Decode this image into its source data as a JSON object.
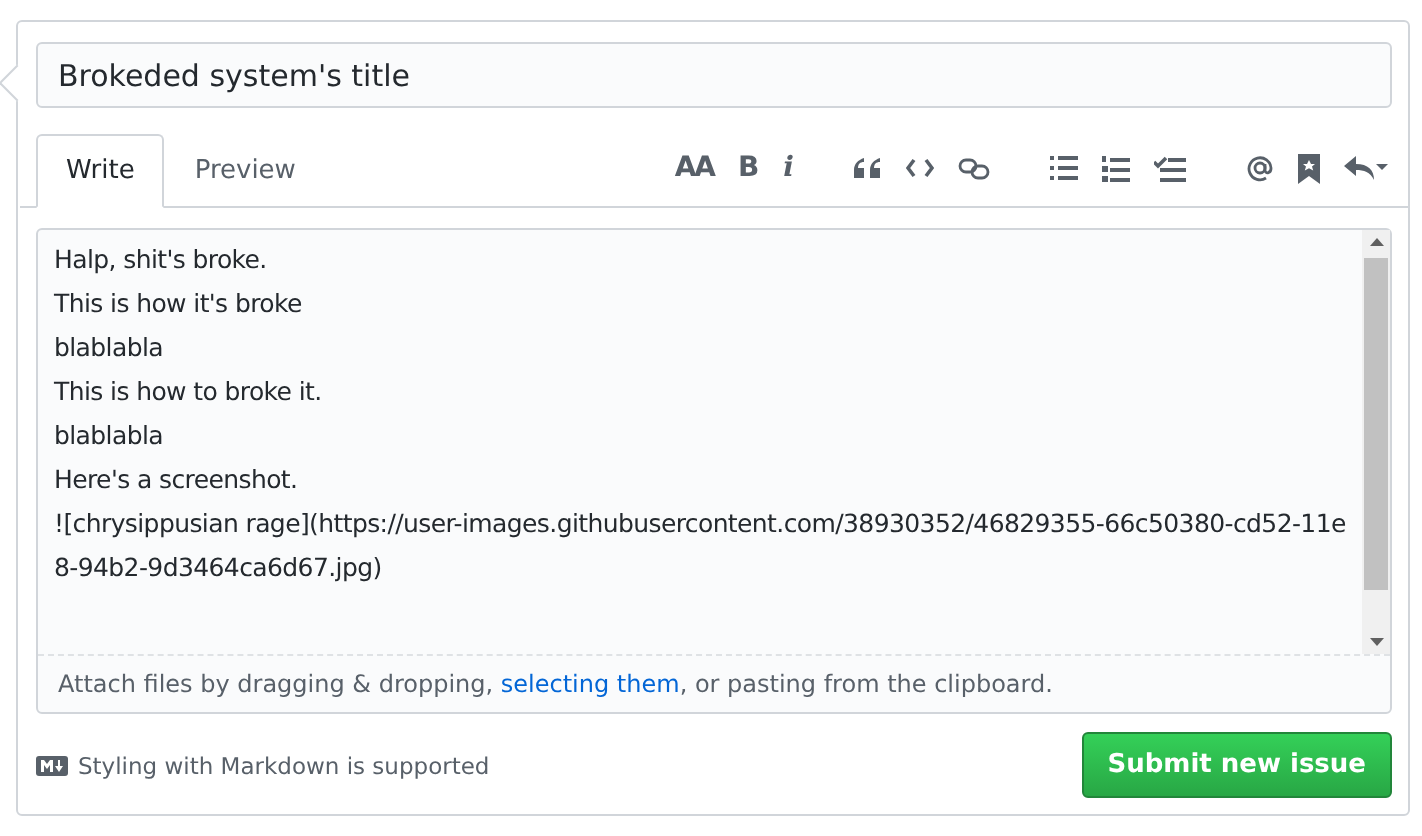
{
  "title_field": {
    "value": "Brokeded system's title"
  },
  "tabs": [
    {
      "label": "Write",
      "selected": true
    },
    {
      "label": "Preview",
      "selected": false
    }
  ],
  "toolbar": [
    [
      {
        "kind": "heading",
        "glyph": "AA"
      },
      {
        "kind": "bold",
        "glyph": "B"
      },
      {
        "kind": "italic",
        "glyph": "i"
      }
    ],
    [
      {
        "kind": "quote"
      },
      {
        "kind": "code"
      },
      {
        "kind": "link"
      }
    ],
    [
      {
        "kind": "bullets"
      },
      {
        "kind": "numbers"
      },
      {
        "kind": "tasks"
      }
    ],
    [
      {
        "kind": "mention"
      },
      {
        "kind": "bookmark"
      },
      {
        "kind": "reply"
      }
    ]
  ],
  "body_field": {
    "lines": [
      "Halp, shit's broke.",
      "This is how it's broke",
      "blablabla",
      "This is how to broke it.",
      "blablabla",
      "Here's a screenshot.",
      "![chrysippusian rage](https://user-images.githubusercontent.com/38930352/46829355-66c50380-cd52-11e8-94b2-9d3464ca6d67.jpg)"
    ]
  },
  "attach": {
    "before": "Attach files by dragging & dropping, ",
    "link": "selecting them",
    "after": ", or pasting from the clipboard."
  },
  "markdown_note": "Styling with Markdown is supported",
  "submit_button": "Submit new issue"
}
